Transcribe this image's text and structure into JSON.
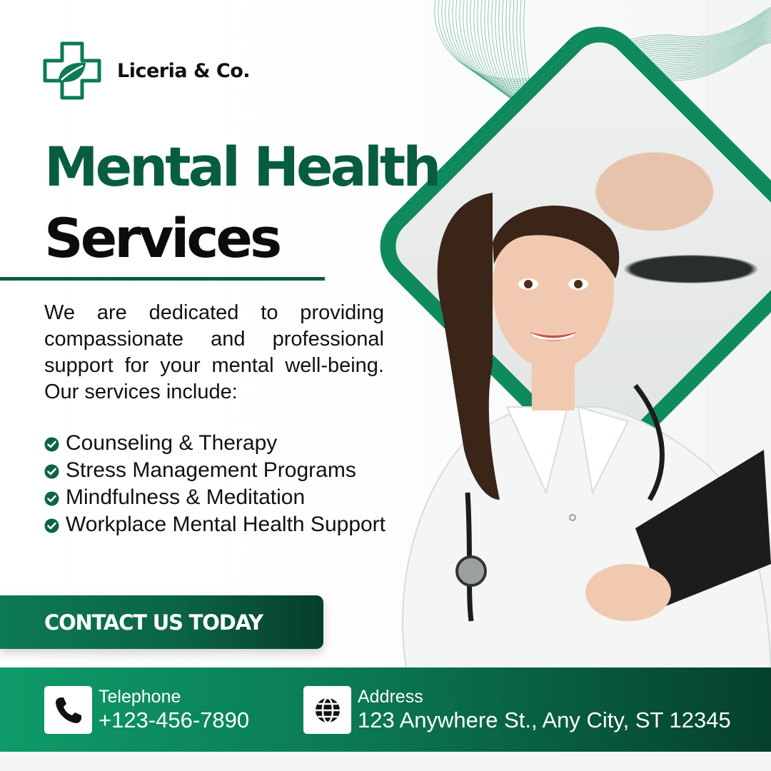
{
  "brand": {
    "name": "Liceria & Co.",
    "logo_icon": "medical-cross-leaf-icon"
  },
  "headline": {
    "line1": "Mental Health",
    "line2": "Services"
  },
  "intro": "We are dedicated to providing compassionate and professional support for your mental well-being. Our services include:",
  "services": [
    "Counseling & Therapy",
    "Stress Management Programs",
    "Mindfulness & Meditation",
    "Workplace Mental Health Support"
  ],
  "cta": {
    "label": "CONTACT US TODAY"
  },
  "contacts": {
    "telephone": {
      "label": "Telephone",
      "value": "+123-456-7890",
      "icon": "phone-icon"
    },
    "address": {
      "label": "Address",
      "value": "123 Anywhere St., Any City, ST 12345",
      "icon": "globe-icon"
    }
  },
  "colors": {
    "primary": "#0b6447",
    "accent": "#0e8a5c",
    "dark_green": "#085c42",
    "text": "#111111"
  }
}
